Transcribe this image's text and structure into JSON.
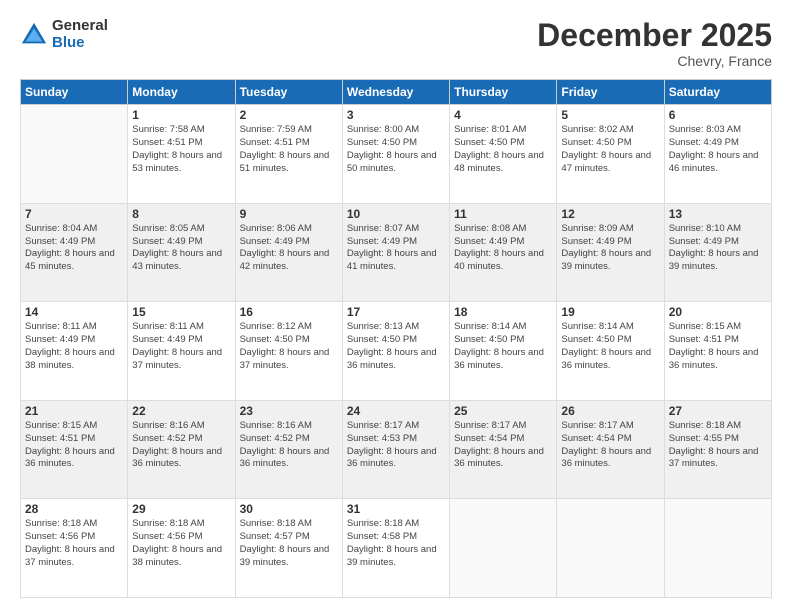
{
  "logo": {
    "general": "General",
    "blue": "Blue"
  },
  "title": "December 2025",
  "location": "Chevry, France",
  "days_header": [
    "Sunday",
    "Monday",
    "Tuesday",
    "Wednesday",
    "Thursday",
    "Friday",
    "Saturday"
  ],
  "weeks": [
    [
      {
        "day": "",
        "sunrise": "",
        "sunset": "",
        "daylight": ""
      },
      {
        "day": "1",
        "sunrise": "Sunrise: 7:58 AM",
        "sunset": "Sunset: 4:51 PM",
        "daylight": "Daylight: 8 hours and 53 minutes."
      },
      {
        "day": "2",
        "sunrise": "Sunrise: 7:59 AM",
        "sunset": "Sunset: 4:51 PM",
        "daylight": "Daylight: 8 hours and 51 minutes."
      },
      {
        "day": "3",
        "sunrise": "Sunrise: 8:00 AM",
        "sunset": "Sunset: 4:50 PM",
        "daylight": "Daylight: 8 hours and 50 minutes."
      },
      {
        "day": "4",
        "sunrise": "Sunrise: 8:01 AM",
        "sunset": "Sunset: 4:50 PM",
        "daylight": "Daylight: 8 hours and 48 minutes."
      },
      {
        "day": "5",
        "sunrise": "Sunrise: 8:02 AM",
        "sunset": "Sunset: 4:50 PM",
        "daylight": "Daylight: 8 hours and 47 minutes."
      },
      {
        "day": "6",
        "sunrise": "Sunrise: 8:03 AM",
        "sunset": "Sunset: 4:49 PM",
        "daylight": "Daylight: 8 hours and 46 minutes."
      }
    ],
    [
      {
        "day": "7",
        "sunrise": "Sunrise: 8:04 AM",
        "sunset": "Sunset: 4:49 PM",
        "daylight": "Daylight: 8 hours and 45 minutes."
      },
      {
        "day": "8",
        "sunrise": "Sunrise: 8:05 AM",
        "sunset": "Sunset: 4:49 PM",
        "daylight": "Daylight: 8 hours and 43 minutes."
      },
      {
        "day": "9",
        "sunrise": "Sunrise: 8:06 AM",
        "sunset": "Sunset: 4:49 PM",
        "daylight": "Daylight: 8 hours and 42 minutes."
      },
      {
        "day": "10",
        "sunrise": "Sunrise: 8:07 AM",
        "sunset": "Sunset: 4:49 PM",
        "daylight": "Daylight: 8 hours and 41 minutes."
      },
      {
        "day": "11",
        "sunrise": "Sunrise: 8:08 AM",
        "sunset": "Sunset: 4:49 PM",
        "daylight": "Daylight: 8 hours and 40 minutes."
      },
      {
        "day": "12",
        "sunrise": "Sunrise: 8:09 AM",
        "sunset": "Sunset: 4:49 PM",
        "daylight": "Daylight: 8 hours and 39 minutes."
      },
      {
        "day": "13",
        "sunrise": "Sunrise: 8:10 AM",
        "sunset": "Sunset: 4:49 PM",
        "daylight": "Daylight: 8 hours and 39 minutes."
      }
    ],
    [
      {
        "day": "14",
        "sunrise": "Sunrise: 8:11 AM",
        "sunset": "Sunset: 4:49 PM",
        "daylight": "Daylight: 8 hours and 38 minutes."
      },
      {
        "day": "15",
        "sunrise": "Sunrise: 8:11 AM",
        "sunset": "Sunset: 4:49 PM",
        "daylight": "Daylight: 8 hours and 37 minutes."
      },
      {
        "day": "16",
        "sunrise": "Sunrise: 8:12 AM",
        "sunset": "Sunset: 4:50 PM",
        "daylight": "Daylight: 8 hours and 37 minutes."
      },
      {
        "day": "17",
        "sunrise": "Sunrise: 8:13 AM",
        "sunset": "Sunset: 4:50 PM",
        "daylight": "Daylight: 8 hours and 36 minutes."
      },
      {
        "day": "18",
        "sunrise": "Sunrise: 8:14 AM",
        "sunset": "Sunset: 4:50 PM",
        "daylight": "Daylight: 8 hours and 36 minutes."
      },
      {
        "day": "19",
        "sunrise": "Sunrise: 8:14 AM",
        "sunset": "Sunset: 4:50 PM",
        "daylight": "Daylight: 8 hours and 36 minutes."
      },
      {
        "day": "20",
        "sunrise": "Sunrise: 8:15 AM",
        "sunset": "Sunset: 4:51 PM",
        "daylight": "Daylight: 8 hours and 36 minutes."
      }
    ],
    [
      {
        "day": "21",
        "sunrise": "Sunrise: 8:15 AM",
        "sunset": "Sunset: 4:51 PM",
        "daylight": "Daylight: 8 hours and 36 minutes."
      },
      {
        "day": "22",
        "sunrise": "Sunrise: 8:16 AM",
        "sunset": "Sunset: 4:52 PM",
        "daylight": "Daylight: 8 hours and 36 minutes."
      },
      {
        "day": "23",
        "sunrise": "Sunrise: 8:16 AM",
        "sunset": "Sunset: 4:52 PM",
        "daylight": "Daylight: 8 hours and 36 minutes."
      },
      {
        "day": "24",
        "sunrise": "Sunrise: 8:17 AM",
        "sunset": "Sunset: 4:53 PM",
        "daylight": "Daylight: 8 hours and 36 minutes."
      },
      {
        "day": "25",
        "sunrise": "Sunrise: 8:17 AM",
        "sunset": "Sunset: 4:54 PM",
        "daylight": "Daylight: 8 hours and 36 minutes."
      },
      {
        "day": "26",
        "sunrise": "Sunrise: 8:17 AM",
        "sunset": "Sunset: 4:54 PM",
        "daylight": "Daylight: 8 hours and 36 minutes."
      },
      {
        "day": "27",
        "sunrise": "Sunrise: 8:18 AM",
        "sunset": "Sunset: 4:55 PM",
        "daylight": "Daylight: 8 hours and 37 minutes."
      }
    ],
    [
      {
        "day": "28",
        "sunrise": "Sunrise: 8:18 AM",
        "sunset": "Sunset: 4:56 PM",
        "daylight": "Daylight: 8 hours and 37 minutes."
      },
      {
        "day": "29",
        "sunrise": "Sunrise: 8:18 AM",
        "sunset": "Sunset: 4:56 PM",
        "daylight": "Daylight: 8 hours and 38 minutes."
      },
      {
        "day": "30",
        "sunrise": "Sunrise: 8:18 AM",
        "sunset": "Sunset: 4:57 PM",
        "daylight": "Daylight: 8 hours and 39 minutes."
      },
      {
        "day": "31",
        "sunrise": "Sunrise: 8:18 AM",
        "sunset": "Sunset: 4:58 PM",
        "daylight": "Daylight: 8 hours and 39 minutes."
      },
      {
        "day": "",
        "sunrise": "",
        "sunset": "",
        "daylight": ""
      },
      {
        "day": "",
        "sunrise": "",
        "sunset": "",
        "daylight": ""
      },
      {
        "day": "",
        "sunrise": "",
        "sunset": "",
        "daylight": ""
      }
    ]
  ]
}
